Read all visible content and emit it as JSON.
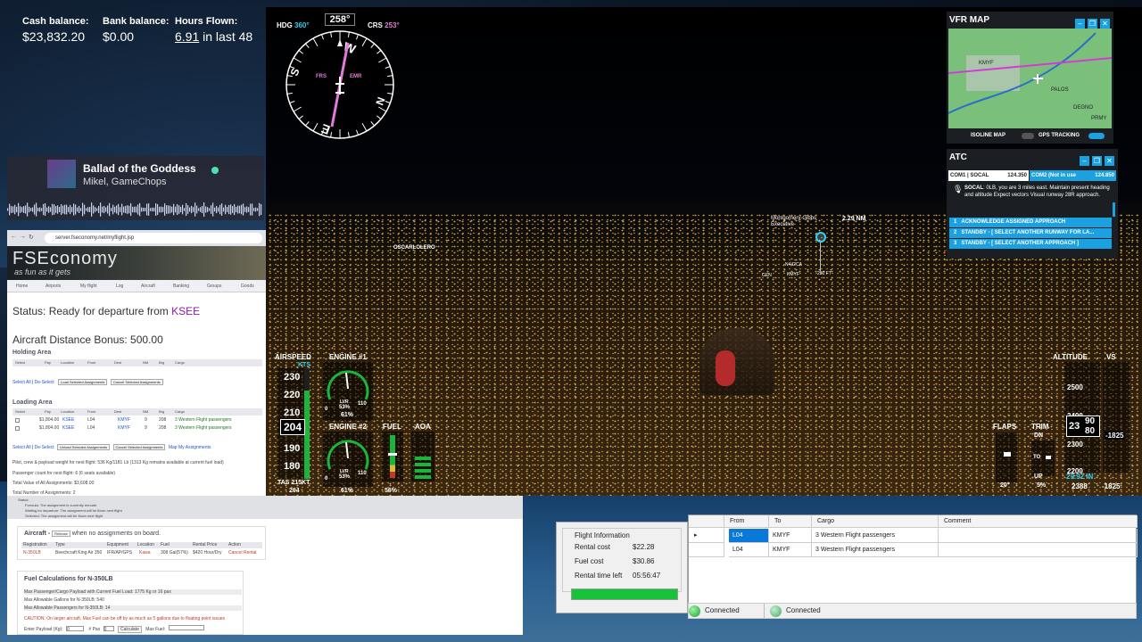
{
  "stats": {
    "cash_label": "Cash balance:",
    "cash_value": "$23,832.20",
    "bank_label": "Bank balance:",
    "bank_value": "$0.00",
    "hours_label": "Hours Flown:",
    "hours_value": "6.91",
    "hours_suffix": "in last 48"
  },
  "music": {
    "title": "Ballad of the Goddess",
    "artist": "Mikel, GameChops"
  },
  "browser": {
    "url": "server.fseconomy.net/myflight.jsp",
    "logo": "FSEconomy",
    "tagline": "as fun as it gets",
    "nav": [
      "Home",
      "Airports",
      "My flight",
      "Log",
      "Aircraft",
      "Banking",
      "Groups",
      "Goods"
    ],
    "status_prefix": "Status: Ready for departure from",
    "status_airport": "KSEE",
    "bonus": "Aircraft Distance Bonus: 500.00",
    "holding_title": "Holding Area",
    "columns": [
      "Select",
      "Pay",
      "Location",
      "From",
      "Dest",
      "NM",
      "Brg",
      "Cargo"
    ],
    "select_all": "Select All",
    "deselect": "De-Select",
    "load_btn": "Load Selected Assignments",
    "cancel_btn": "Cancel Selected Assignments",
    "loading_title": "Loading Area",
    "loading_rows": [
      {
        "pay": "$1,804.00",
        "loc": "KSEE",
        "from": "L04",
        "dest": "KMYF",
        "nm": "9",
        "brg": "208",
        "cargo": "3 Western Flight passengers"
      },
      {
        "pay": "$1,804.00",
        "loc": "KSEE",
        "from": "L04",
        "dest": "KMYF",
        "nm": "9",
        "brg": "208",
        "cargo": "3 Western Flight passengers"
      }
    ],
    "unload_btn": "Unload Selected Assignments",
    "map_link": "Map My Assignments",
    "pilot_line": "Pilot, crew & payload weight for next flight: 536 Kg/1181 Lb (1313 Kg remains available at current fuel load)",
    "pax_line": "Passenger count for next flight: 6 (6 seats available)",
    "total_value": "Total Value of All Assignments: $3,608.00",
    "total_num": "Total Number of Assignments: 2",
    "status_legend": "Status:",
    "legend": [
      "Formula: The assignment is currently enroute",
      "Waiting for departure: The assignment will be flown next flight",
      "Selected: The assignment will be flown next flight"
    ],
    "aircraft_prefix": "Aircraft -",
    "aircraft_btn": "Release",
    "aircraft_suffix": "when no assignments on board.",
    "ac_cols": [
      "Registration",
      "Type",
      "Equipment",
      "Location",
      "Fuel",
      "Rental Price",
      "Action"
    ],
    "ac_row": {
      "reg": "N-350LB",
      "type": "Beechcraft King Air 350",
      "equip": "IFR/AP/GPS",
      "loc": "Kawa",
      "fuel": "308 Gal(57%)",
      "price": "$420 Hour/Dry",
      "action": "Cancel Rental"
    },
    "fuel_title": "Fuel Calculations for N-350LB",
    "fuel_lines": [
      "Max Passenger/Cargo Payload with Current Fuel Load: 1775 Kg or 16 pax",
      "Max Allowable Gallons for N-350LB: 540",
      "Max Allowable Passengers for N-350LB: 14"
    ],
    "caution": "CAUTION: On larger aircraft, Max Fuel can be off by as much as 5 gallons due to floating point issues",
    "payload_label": "Enter Payload (Kg):",
    "payload_value": "0",
    "pax_label": "# Pax",
    "pax_value": "0",
    "calc_btn": "Calculate",
    "maxfuel_label": "Max Fuel:"
  },
  "compass": {
    "hdg_label": "HDG",
    "hdg_value": "360°",
    "heading": "258°",
    "crs_label": "CRS",
    "crs_value": "253°",
    "frs": "FRS",
    "emr": "EMR"
  },
  "vfr": {
    "title": "VFR MAP",
    "isoline": "ISOLINE MAP",
    "gps": "GPS TRACKING",
    "labels": [
      "KMYF",
      "PALOS",
      "DEGNO",
      "PRMY"
    ]
  },
  "atc": {
    "title": "ATC",
    "com1": "COM1 | SOCAL",
    "com1_freq": "124.350",
    "com2": "COM2 (Not in use",
    "com2_freq": "124.850",
    "msg_from": "SOCAL",
    "msg": ": 0LB, you are 3 miles east. Maintain present heading and altitude Expect vectors Visual runway 28R approach.",
    "options": [
      {
        "num": "1",
        "text": "ACKNOWLEDGE ASSIGNED APPROACH"
      },
      {
        "num": "2",
        "text": "STANDBY - [ SELECT ANOTHER RUNWAY FOR LA..."
      },
      {
        "num": "3",
        "text": "STANDBY - [ SELECT ANOTHER APPROACH ]"
      }
    ]
  },
  "scene": {
    "airport": "Montgomery-Gibbs Executive",
    "distance": "2.29 NM",
    "waypoint": "OSCARLOLERO",
    "tags": [
      "N442CA",
      "KMYF",
      "GEN",
      "280 FT"
    ]
  },
  "instruments": {
    "airspeed_label": "AIRSPEED",
    "kts": "KTS",
    "speed_ticks": [
      "230",
      "220",
      "210",
      "200",
      "190",
      "180"
    ],
    "speed_value": "204",
    "tas": "TAS 215KT",
    "tas_value": "204",
    "engine1_label": "ENGINE #1",
    "engine1_pct": "53%",
    "engine1_n": "61%",
    "engine2_label": "ENGINE #2",
    "engine2_pct": "53%",
    "engine2_n": "61%",
    "lvr": "LVR",
    "g0": "0",
    "g110": "110",
    "fuel_label": "FUEL",
    "fuel_value": "56%",
    "aoa_label": "AOA",
    "flaps_label": "FLAPS",
    "flaps_value": "20°",
    "trim_label": "TRIM",
    "trim_dn": "DN",
    "trim_to": "TO",
    "trim_up": "UP",
    "trim_value": "5%",
    "alt_label": "ALTITUDE",
    "alt_ticks": [
      "2500",
      "2400",
      "2300",
      "2200"
    ],
    "alt_v1": "23",
    "alt_v2": "90",
    "alt_v3": "80",
    "baro": "29.92 IN",
    "alt_value": "2388",
    "vs_label": "VS",
    "vs_value": "-1825",
    "vs_value2": "-1825"
  },
  "flight_info": {
    "legend": "Flight Information",
    "rental_label": "Rental cost",
    "rental_value": "$22.28",
    "fuel_label": "Fuel cost",
    "fuel_value": "$30.86",
    "time_label": "Rental time left",
    "time_value": "05:56:47"
  },
  "grid": {
    "headers": [
      "From",
      "To",
      "Cargo",
      "Comment"
    ],
    "rows": [
      {
        "from": "L04",
        "to": "KMYF",
        "cargo": "3 Western Flight passengers",
        "comment": ""
      },
      {
        "from": "L04",
        "to": "KMYF",
        "cargo": "3 Western Flight passengers",
        "comment": ""
      }
    ]
  },
  "status": {
    "conn1": "Connected",
    "conn2": "Connected"
  }
}
